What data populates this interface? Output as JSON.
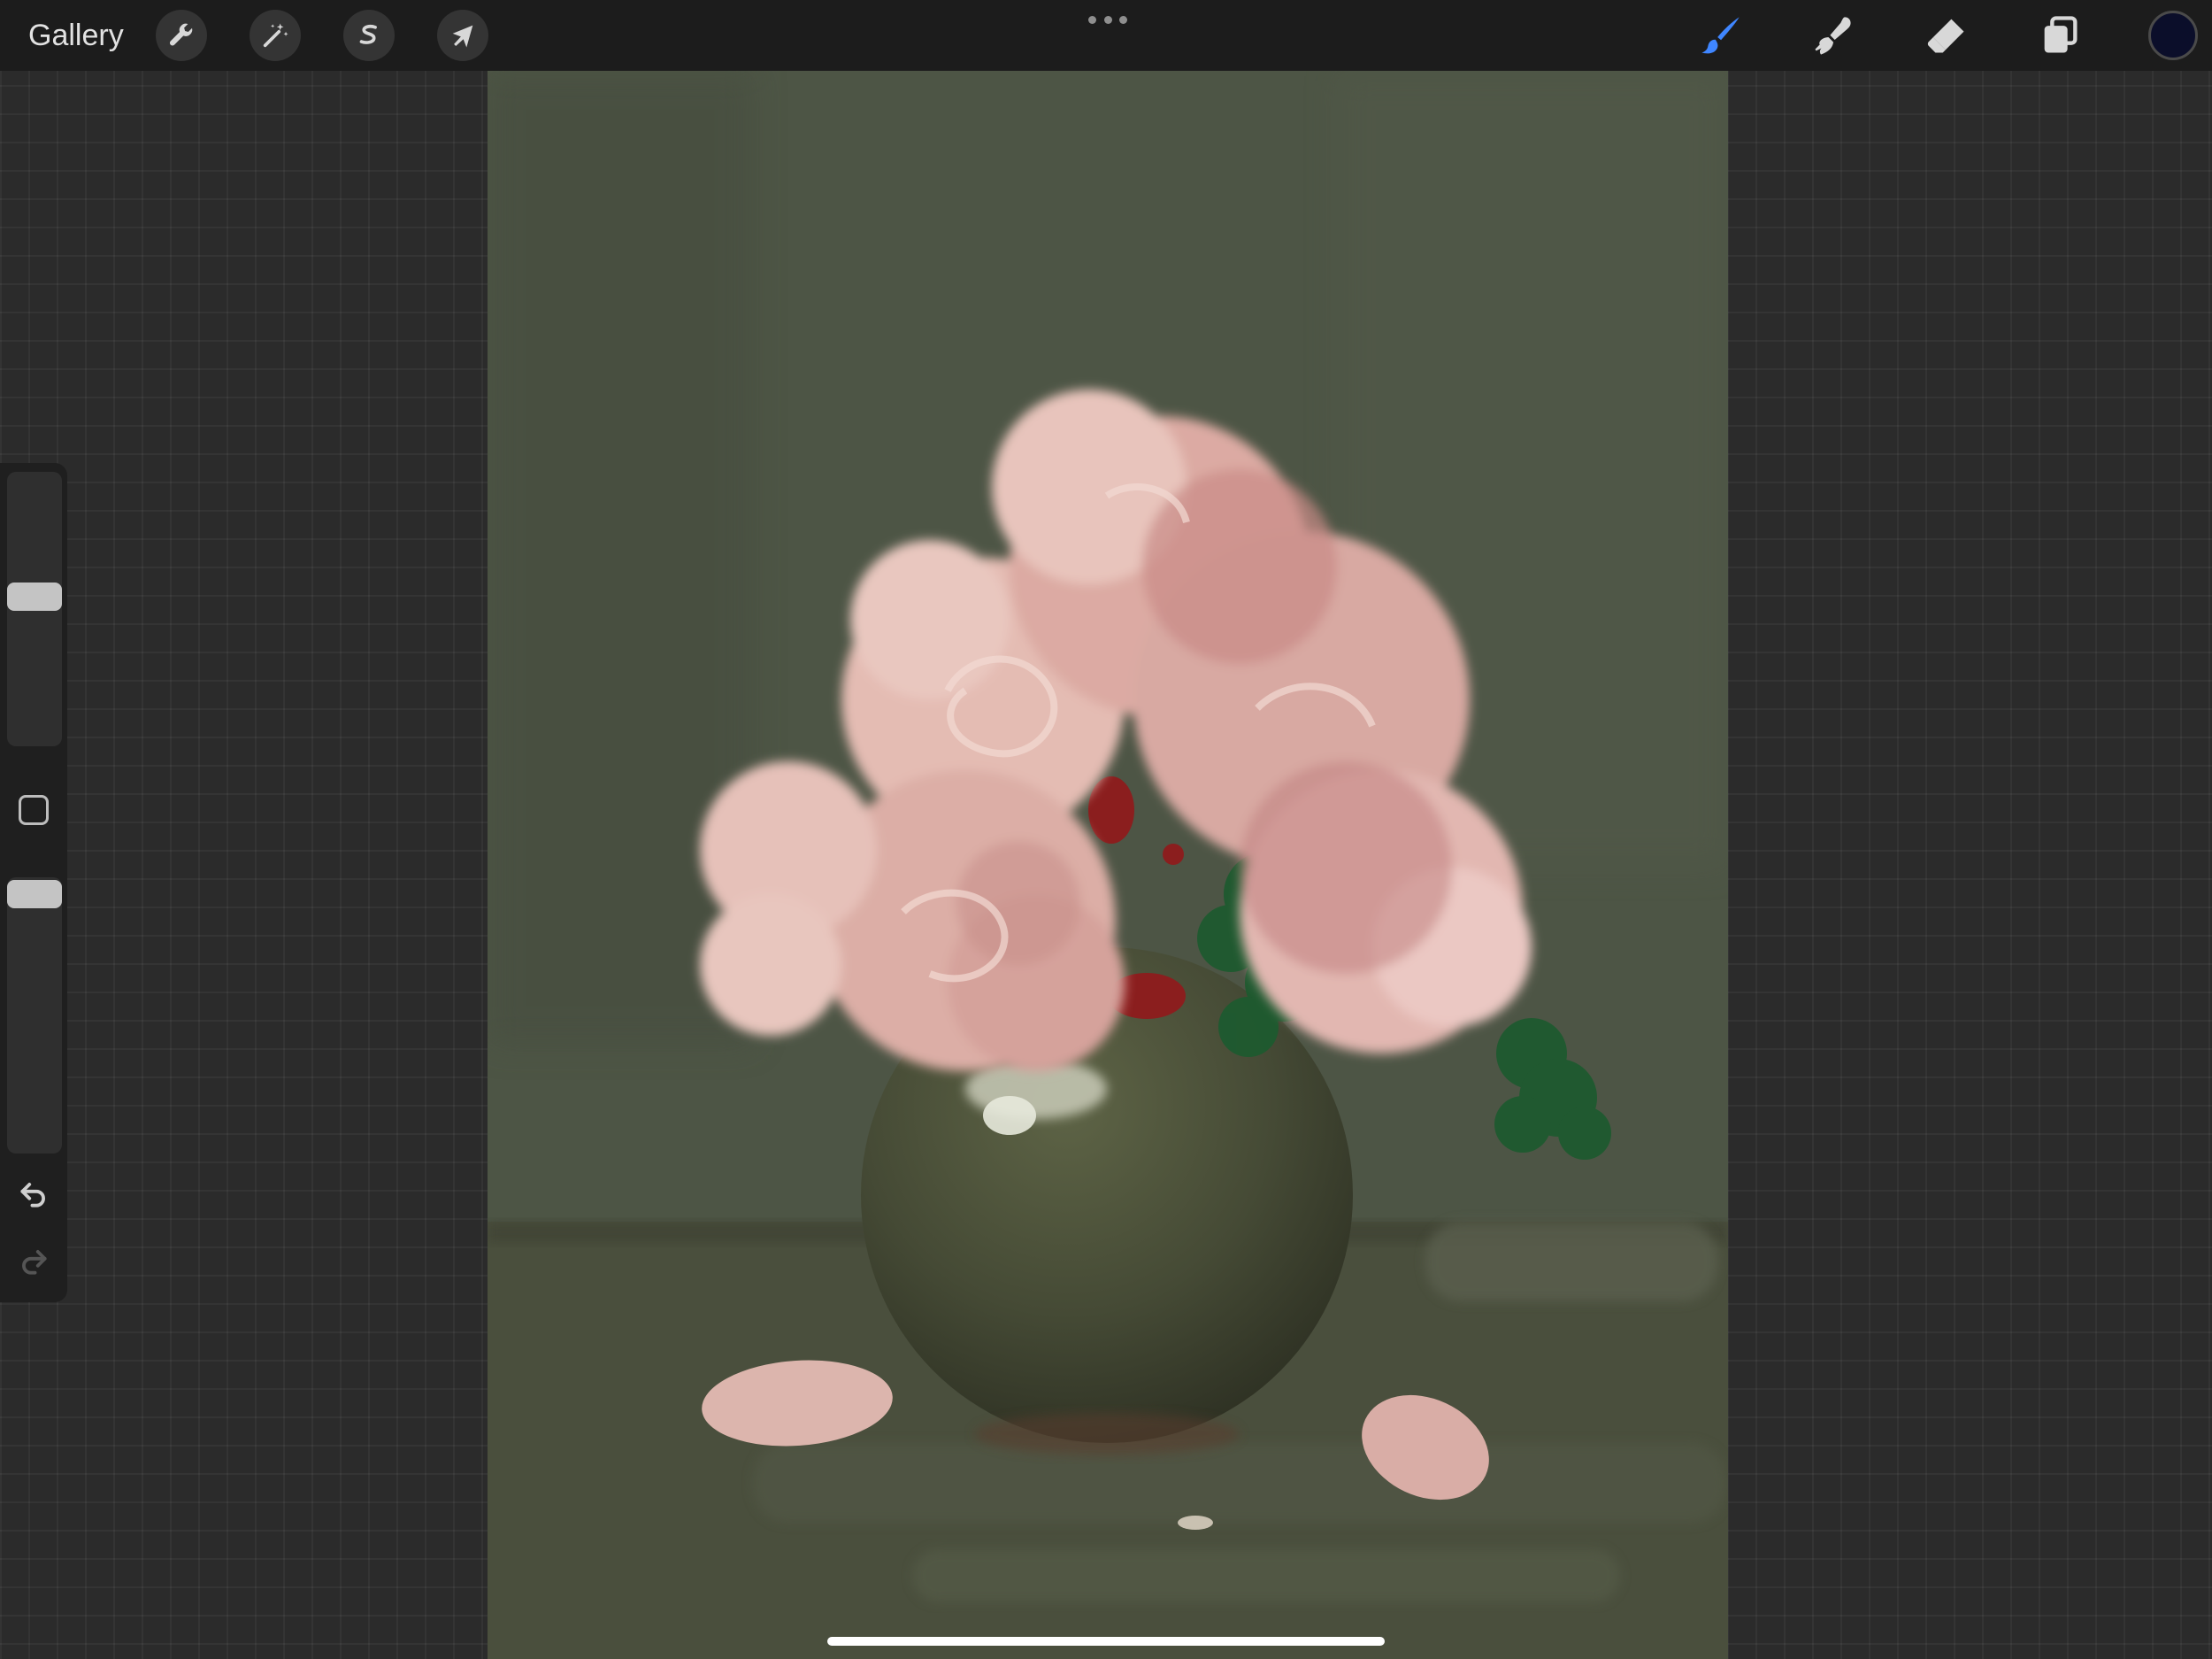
{
  "app": {
    "gallery_label": "Gallery"
  },
  "toolbar": {
    "left_icons": [
      "wrench-icon",
      "magic-wand-icon",
      "selection-s-icon",
      "arrow-cursor-icon"
    ],
    "right_icons": [
      "brush-icon",
      "smudge-icon",
      "eraser-icon",
      "layers-icon"
    ],
    "active_tool": "brush",
    "active_tool_color": "#3f86ff",
    "current_color": "#0b0e2a"
  },
  "sidebar": {
    "brush_size": 0.55,
    "opacity": 1.0,
    "undo_icon": "undo-arrow-icon",
    "redo_icon": "redo-arrow-icon",
    "redo_enabled": false
  }
}
